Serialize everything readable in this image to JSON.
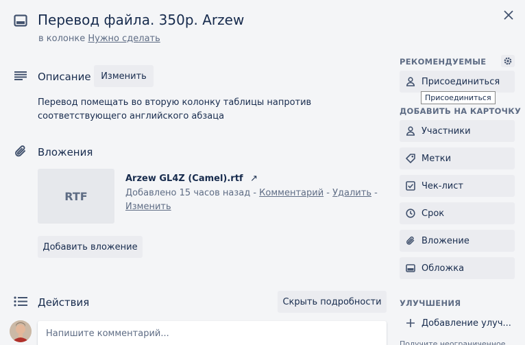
{
  "card": {
    "title": "Перевод файла. 350р. Arzew",
    "column_prefix": "в колонке",
    "column_name": "Нужно сделать"
  },
  "description": {
    "heading": "Описание",
    "edit_label": "Изменить",
    "text": "Перевод помещать во вторую колонку таблицы напротив соответствующего английского абзаца"
  },
  "attachments": {
    "heading": "Вложения",
    "items": [
      {
        "thumb_label": "RTF",
        "name": "Arzew GL4Z (Camel).rtf",
        "added": "Добавлено 15 часов назад",
        "comment_label": "Комментарий",
        "delete_label": "Удалить",
        "edit_label": "Изменить"
      }
    ],
    "add_label": "Добавить вложение"
  },
  "activity": {
    "heading": "Действия",
    "hide_details_label": "Скрыть подробности",
    "comment_placeholder": "Напишите комментарий..."
  },
  "sidebar": {
    "suggested_heading": "РЕКОМЕНДУЕМЫЕ",
    "join_label": "Присоединиться",
    "join_tooltip": "Присоединиться",
    "add_heading": "ДОБАВИТЬ НА КАРТОЧКУ",
    "add_items": [
      {
        "label": "Участники",
        "icon": "person-icon"
      },
      {
        "label": "Метки",
        "icon": "tag-icon"
      },
      {
        "label": "Чек-лист",
        "icon": "checklist-icon"
      },
      {
        "label": "Срок",
        "icon": "clock-icon"
      },
      {
        "label": "Вложение",
        "icon": "paperclip-icon"
      },
      {
        "label": "Обложка",
        "icon": "cover-icon"
      }
    ],
    "powerups_heading": "УЛУЧШЕНИЯ",
    "add_powerup_label": "Добавление улуч...",
    "more_text": "Получите неограниченное"
  },
  "colors": {
    "background": "#f4f5f7",
    "button": "#ebecf0",
    "text": "#172b4d",
    "muted": "#5e6c84"
  }
}
